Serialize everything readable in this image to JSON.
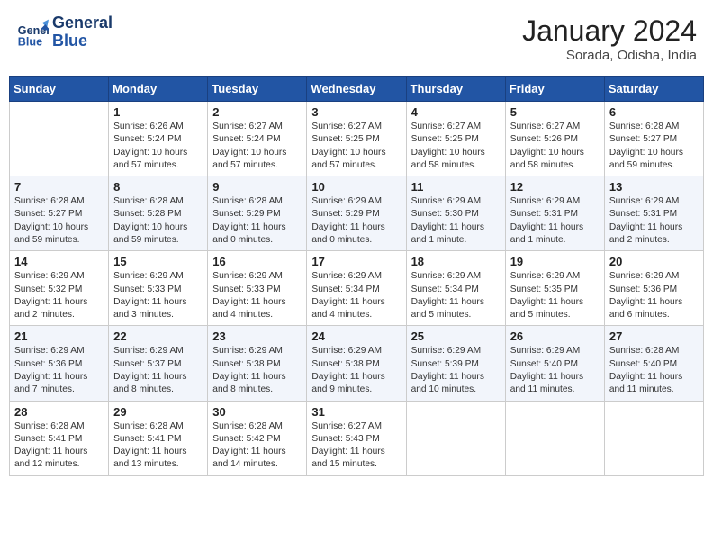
{
  "header": {
    "logo_line1": "General",
    "logo_line2": "Blue",
    "month": "January 2024",
    "location": "Sorada, Odisha, India"
  },
  "weekdays": [
    "Sunday",
    "Monday",
    "Tuesday",
    "Wednesday",
    "Thursday",
    "Friday",
    "Saturday"
  ],
  "weeks": [
    [
      {
        "day": null,
        "sunrise": null,
        "sunset": null,
        "daylight": null
      },
      {
        "day": "1",
        "sunrise": "Sunrise: 6:26 AM",
        "sunset": "Sunset: 5:24 PM",
        "daylight": "Daylight: 10 hours and 57 minutes."
      },
      {
        "day": "2",
        "sunrise": "Sunrise: 6:27 AM",
        "sunset": "Sunset: 5:24 PM",
        "daylight": "Daylight: 10 hours and 57 minutes."
      },
      {
        "day": "3",
        "sunrise": "Sunrise: 6:27 AM",
        "sunset": "Sunset: 5:25 PM",
        "daylight": "Daylight: 10 hours and 57 minutes."
      },
      {
        "day": "4",
        "sunrise": "Sunrise: 6:27 AM",
        "sunset": "Sunset: 5:25 PM",
        "daylight": "Daylight: 10 hours and 58 minutes."
      },
      {
        "day": "5",
        "sunrise": "Sunrise: 6:27 AM",
        "sunset": "Sunset: 5:26 PM",
        "daylight": "Daylight: 10 hours and 58 minutes."
      },
      {
        "day": "6",
        "sunrise": "Sunrise: 6:28 AM",
        "sunset": "Sunset: 5:27 PM",
        "daylight": "Daylight: 10 hours and 59 minutes."
      }
    ],
    [
      {
        "day": "7",
        "sunrise": "Sunrise: 6:28 AM",
        "sunset": "Sunset: 5:27 PM",
        "daylight": "Daylight: 10 hours and 59 minutes."
      },
      {
        "day": "8",
        "sunrise": "Sunrise: 6:28 AM",
        "sunset": "Sunset: 5:28 PM",
        "daylight": "Daylight: 10 hours and 59 minutes."
      },
      {
        "day": "9",
        "sunrise": "Sunrise: 6:28 AM",
        "sunset": "Sunset: 5:29 PM",
        "daylight": "Daylight: 11 hours and 0 minutes."
      },
      {
        "day": "10",
        "sunrise": "Sunrise: 6:29 AM",
        "sunset": "Sunset: 5:29 PM",
        "daylight": "Daylight: 11 hours and 0 minutes."
      },
      {
        "day": "11",
        "sunrise": "Sunrise: 6:29 AM",
        "sunset": "Sunset: 5:30 PM",
        "daylight": "Daylight: 11 hours and 1 minute."
      },
      {
        "day": "12",
        "sunrise": "Sunrise: 6:29 AM",
        "sunset": "Sunset: 5:31 PM",
        "daylight": "Daylight: 11 hours and 1 minute."
      },
      {
        "day": "13",
        "sunrise": "Sunrise: 6:29 AM",
        "sunset": "Sunset: 5:31 PM",
        "daylight": "Daylight: 11 hours and 2 minutes."
      }
    ],
    [
      {
        "day": "14",
        "sunrise": "Sunrise: 6:29 AM",
        "sunset": "Sunset: 5:32 PM",
        "daylight": "Daylight: 11 hours and 2 minutes."
      },
      {
        "day": "15",
        "sunrise": "Sunrise: 6:29 AM",
        "sunset": "Sunset: 5:33 PM",
        "daylight": "Daylight: 11 hours and 3 minutes."
      },
      {
        "day": "16",
        "sunrise": "Sunrise: 6:29 AM",
        "sunset": "Sunset: 5:33 PM",
        "daylight": "Daylight: 11 hours and 4 minutes."
      },
      {
        "day": "17",
        "sunrise": "Sunrise: 6:29 AM",
        "sunset": "Sunset: 5:34 PM",
        "daylight": "Daylight: 11 hours and 4 minutes."
      },
      {
        "day": "18",
        "sunrise": "Sunrise: 6:29 AM",
        "sunset": "Sunset: 5:34 PM",
        "daylight": "Daylight: 11 hours and 5 minutes."
      },
      {
        "day": "19",
        "sunrise": "Sunrise: 6:29 AM",
        "sunset": "Sunset: 5:35 PM",
        "daylight": "Daylight: 11 hours and 5 minutes."
      },
      {
        "day": "20",
        "sunrise": "Sunrise: 6:29 AM",
        "sunset": "Sunset: 5:36 PM",
        "daylight": "Daylight: 11 hours and 6 minutes."
      }
    ],
    [
      {
        "day": "21",
        "sunrise": "Sunrise: 6:29 AM",
        "sunset": "Sunset: 5:36 PM",
        "daylight": "Daylight: 11 hours and 7 minutes."
      },
      {
        "day": "22",
        "sunrise": "Sunrise: 6:29 AM",
        "sunset": "Sunset: 5:37 PM",
        "daylight": "Daylight: 11 hours and 8 minutes."
      },
      {
        "day": "23",
        "sunrise": "Sunrise: 6:29 AM",
        "sunset": "Sunset: 5:38 PM",
        "daylight": "Daylight: 11 hours and 8 minutes."
      },
      {
        "day": "24",
        "sunrise": "Sunrise: 6:29 AM",
        "sunset": "Sunset: 5:38 PM",
        "daylight": "Daylight: 11 hours and 9 minutes."
      },
      {
        "day": "25",
        "sunrise": "Sunrise: 6:29 AM",
        "sunset": "Sunset: 5:39 PM",
        "daylight": "Daylight: 11 hours and 10 minutes."
      },
      {
        "day": "26",
        "sunrise": "Sunrise: 6:29 AM",
        "sunset": "Sunset: 5:40 PM",
        "daylight": "Daylight: 11 hours and 11 minutes."
      },
      {
        "day": "27",
        "sunrise": "Sunrise: 6:28 AM",
        "sunset": "Sunset: 5:40 PM",
        "daylight": "Daylight: 11 hours and 11 minutes."
      }
    ],
    [
      {
        "day": "28",
        "sunrise": "Sunrise: 6:28 AM",
        "sunset": "Sunset: 5:41 PM",
        "daylight": "Daylight: 11 hours and 12 minutes."
      },
      {
        "day": "29",
        "sunrise": "Sunrise: 6:28 AM",
        "sunset": "Sunset: 5:41 PM",
        "daylight": "Daylight: 11 hours and 13 minutes."
      },
      {
        "day": "30",
        "sunrise": "Sunrise: 6:28 AM",
        "sunset": "Sunset: 5:42 PM",
        "daylight": "Daylight: 11 hours and 14 minutes."
      },
      {
        "day": "31",
        "sunrise": "Sunrise: 6:27 AM",
        "sunset": "Sunset: 5:43 PM",
        "daylight": "Daylight: 11 hours and 15 minutes."
      },
      {
        "day": null,
        "sunrise": null,
        "sunset": null,
        "daylight": null
      },
      {
        "day": null,
        "sunrise": null,
        "sunset": null,
        "daylight": null
      },
      {
        "day": null,
        "sunrise": null,
        "sunset": null,
        "daylight": null
      }
    ]
  ]
}
